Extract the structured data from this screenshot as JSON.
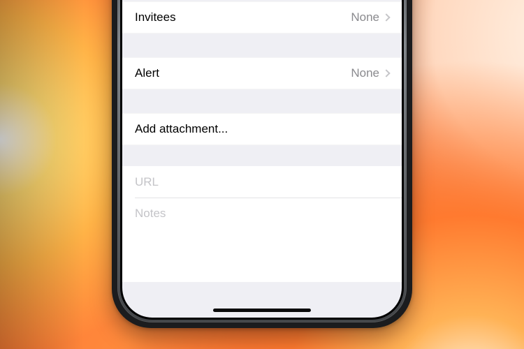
{
  "rows": {
    "invitees": {
      "label": "Invitees",
      "value": "None"
    },
    "alert": {
      "label": "Alert",
      "value": "None"
    },
    "attachment": {
      "label": "Add attachment..."
    }
  },
  "fields": {
    "url": {
      "placeholder": "URL"
    },
    "notes": {
      "placeholder": "Notes"
    }
  }
}
